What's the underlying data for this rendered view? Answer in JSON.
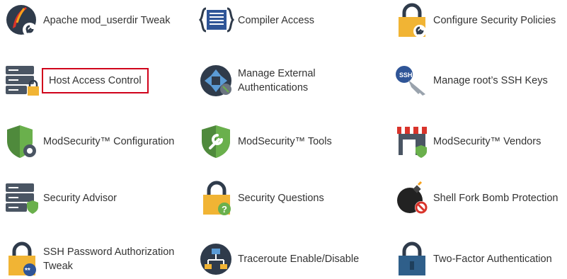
{
  "items": [
    {
      "id": "apache-mod-userdir-tweak",
      "label": "Apache mod_userdir Tweak",
      "icon": "apache-feather-wrench-icon"
    },
    {
      "id": "compiler-access",
      "label": "Compiler Access",
      "icon": "code-braces-icon"
    },
    {
      "id": "configure-security-policies",
      "label": "Configure Security Policies",
      "icon": "padlock-wrench-icon"
    },
    {
      "id": "host-access-control",
      "label": "Host Access Control",
      "icon": "server-lock-icon",
      "highlighted": true
    },
    {
      "id": "manage-external-authentications",
      "label": "Manage External Authentications",
      "icon": "external-auth-arrows-icon"
    },
    {
      "id": "manage-root-ssh-keys",
      "label": "Manage root’s SSH Keys",
      "icon": "ssh-key-icon"
    },
    {
      "id": "modsecurity-configuration",
      "label": "ModSecurity™ Configuration",
      "icon": "shield-gear-icon"
    },
    {
      "id": "modsecurity-tools",
      "label": "ModSecurity™ Tools",
      "icon": "shield-wrench-icon"
    },
    {
      "id": "modsecurity-vendors",
      "label": "ModSecurity™ Vendors",
      "icon": "storefront-shield-icon"
    },
    {
      "id": "security-advisor",
      "label": "Security Advisor",
      "icon": "server-shield-icon"
    },
    {
      "id": "security-questions",
      "label": "Security Questions",
      "icon": "padlock-question-icon"
    },
    {
      "id": "shell-fork-bomb-protection",
      "label": "Shell Fork Bomb Protection",
      "icon": "bomb-no-icon"
    },
    {
      "id": "ssh-password-authorization-tweak",
      "label": "SSH Password Authorization Tweak",
      "icon": "padlock-password-icon"
    },
    {
      "id": "traceroute-enable-disable",
      "label": "Traceroute Enable/Disable",
      "icon": "network-route-icon"
    },
    {
      "id": "two-factor-authentication",
      "label": "Two-Factor Authentication",
      "icon": "padlock-blue-icon"
    }
  ],
  "colors": {
    "highlight_border": "#d0021b",
    "lock_yellow": "#f1b434",
    "dark_navy": "#2f3b4b",
    "shield_green": "#6ab04c"
  }
}
